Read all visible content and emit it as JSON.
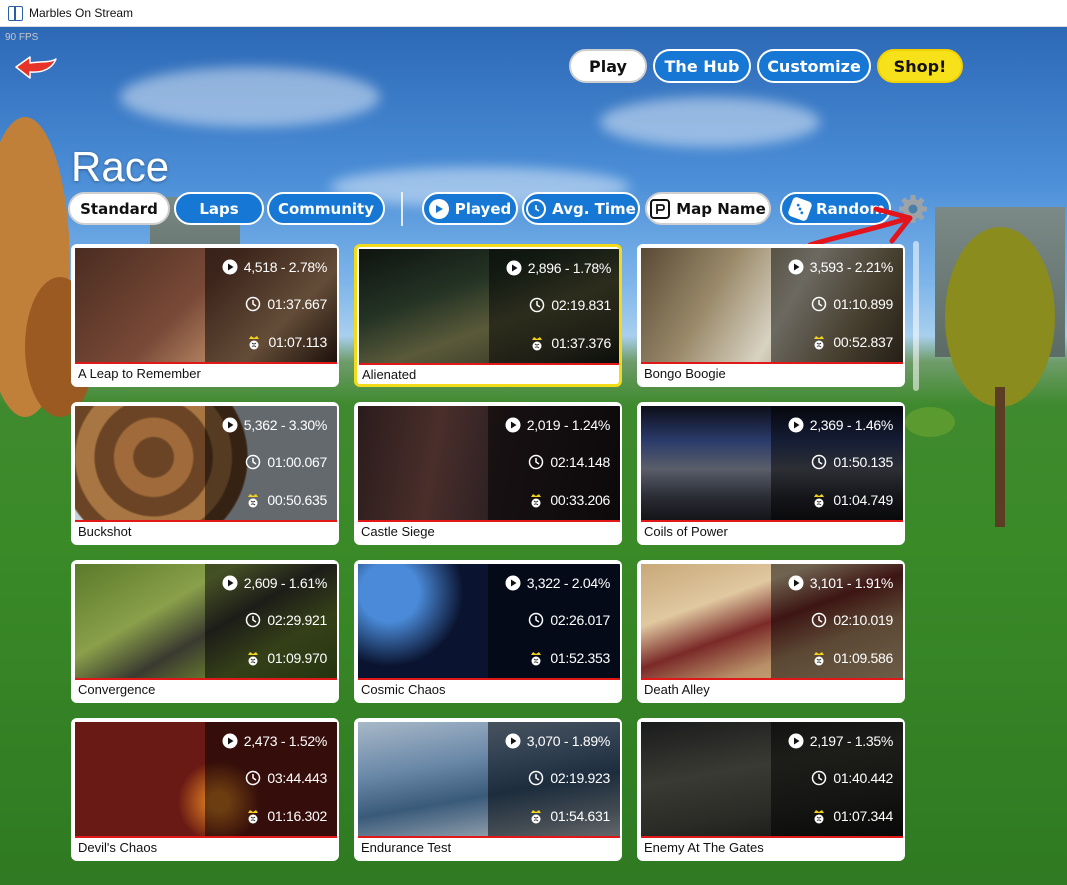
{
  "window": {
    "title": "Marbles On Stream"
  },
  "fps": "90 FPS",
  "top_nav": [
    {
      "label": "Play",
      "style": "white"
    },
    {
      "label": "The Hub",
      "style": "blue"
    },
    {
      "label": "Customize",
      "style": "blue"
    },
    {
      "label": "Shop!",
      "style": "yellow"
    }
  ],
  "page_title": "Race",
  "mode_tabs": [
    {
      "label": "Standard",
      "selected": true
    },
    {
      "label": "Laps",
      "selected": false
    },
    {
      "label": "Community",
      "selected": false
    }
  ],
  "sort_buttons": [
    {
      "label": "Played",
      "icon": "play-icon",
      "style": "blue"
    },
    {
      "label": "Avg. Time",
      "icon": "clock-icon",
      "style": "blue"
    },
    {
      "label": "Map Name",
      "icon": "map-name-icon",
      "style": "white"
    },
    {
      "label": "Random",
      "icon": "dice-icon",
      "style": "blue"
    }
  ],
  "colors": {
    "accent_blue": "#1678d4",
    "shop_yellow": "#f7e11b",
    "selected_border": "#f2dc1a",
    "card_rule": "#e01818"
  },
  "maps": [
    {
      "name": "A Leap to Remember",
      "played": "4,518 - 2.78%",
      "avg_time": "01:37.667",
      "record": "01:07.113",
      "selected": false
    },
    {
      "name": "Alienated",
      "played": "2,896 - 1.78%",
      "avg_time": "02:19.831",
      "record": "01:37.376",
      "selected": true
    },
    {
      "name": "Bongo Boogie",
      "played": "3,593 - 2.21%",
      "avg_time": "01:10.899",
      "record": "00:52.837",
      "selected": false
    },
    {
      "name": "Buckshot",
      "played": "5,362 - 3.30%",
      "avg_time": "01:00.067",
      "record": "00:50.635",
      "selected": false
    },
    {
      "name": "Castle Siege",
      "played": "2,019 - 1.24%",
      "avg_time": "02:14.148",
      "record": "00:33.206",
      "selected": false
    },
    {
      "name": "Coils of Power",
      "played": "2,369 - 1.46%",
      "avg_time": "01:50.135",
      "record": "01:04.749",
      "selected": false
    },
    {
      "name": "Convergence",
      "played": "2,609 - 1.61%",
      "avg_time": "02:29.921",
      "record": "01:09.970",
      "selected": false
    },
    {
      "name": "Cosmic Chaos",
      "played": "3,322 - 2.04%",
      "avg_time": "02:26.017",
      "record": "01:52.353",
      "selected": false
    },
    {
      "name": "Death Alley",
      "played": "3,101 - 1.91%",
      "avg_time": "02:10.019",
      "record": "01:09.586",
      "selected": false
    },
    {
      "name": "Devil's Chaos",
      "played": "2,473 - 1.52%",
      "avg_time": "03:44.443",
      "record": "01:16.302",
      "selected": false
    },
    {
      "name": "Endurance Test",
      "played": "3,070 - 1.89%",
      "avg_time": "02:19.923",
      "record": "01:54.631",
      "selected": false
    },
    {
      "name": "Enemy At The Gates",
      "played": "2,197 - 1.35%",
      "avg_time": "01:40.442",
      "record": "01:07.344",
      "selected": false
    }
  ]
}
